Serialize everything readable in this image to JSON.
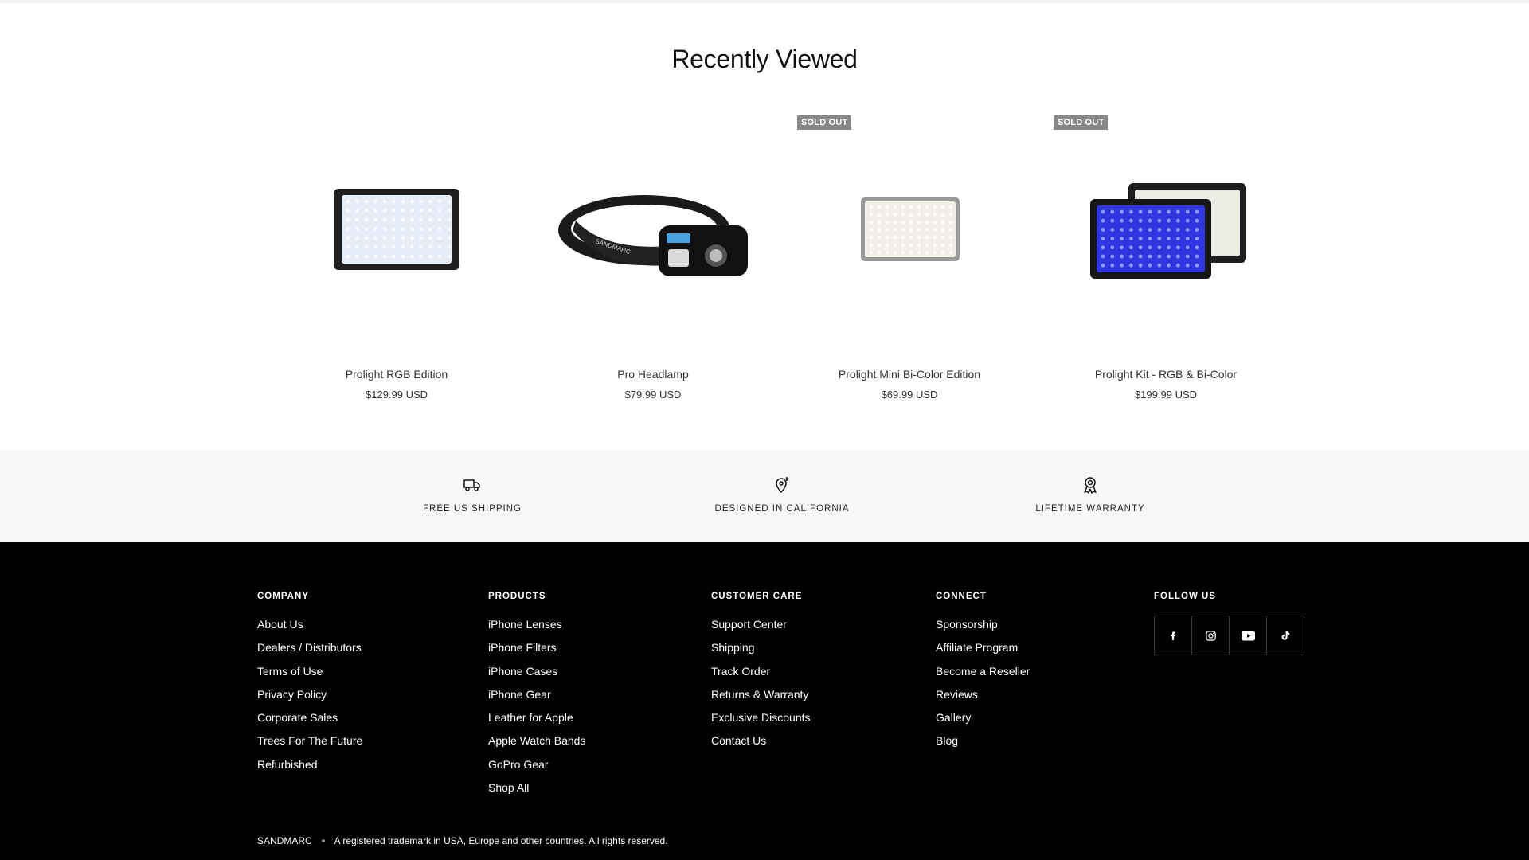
{
  "recently_viewed": {
    "title": "Recently Viewed",
    "products": [
      {
        "name": "Prolight RGB Edition",
        "price": "$129.99 USD",
        "badge": ""
      },
      {
        "name": "Pro Headlamp",
        "price": "$79.99 USD",
        "badge": ""
      },
      {
        "name": "Prolight Mini Bi-Color Edition",
        "price": "$69.99 USD",
        "badge": "SOLD OUT"
      },
      {
        "name": "Prolight Kit - RGB & Bi-Color",
        "price": "$199.99 USD",
        "badge": "SOLD OUT"
      }
    ],
    "headlamp_brand_text": "SANDMARC"
  },
  "features": [
    {
      "label": "FREE US SHIPPING",
      "icon": "truck-icon"
    },
    {
      "label": "DESIGNED IN CALIFORNIA",
      "icon": "location-pin-icon"
    },
    {
      "label": "LIFETIME WARRANTY",
      "icon": "award-ribbon-icon"
    }
  ],
  "footer": {
    "columns": [
      {
        "heading": "COMPANY",
        "links": [
          "About Us",
          "Dealers / Distributors",
          "Terms of Use",
          "Privacy Policy",
          "Corporate Sales",
          "Trees For The Future",
          "Refurbished"
        ]
      },
      {
        "heading": "PRODUCTS",
        "links": [
          "iPhone Lenses",
          "iPhone Filters",
          "iPhone Cases",
          "iPhone Gear",
          "Leather for Apple",
          "Apple Watch Bands",
          "GoPro Gear",
          "Shop All"
        ]
      },
      {
        "heading": "CUSTOMER CARE",
        "links": [
          "Support Center",
          "Shipping",
          "Track Order",
          "Returns & Warranty",
          "Exclusive Discounts",
          "Contact Us"
        ]
      },
      {
        "heading": "CONNECT",
        "links": [
          "Sponsorship",
          "Affiliate Program",
          "Become a Reseller",
          "Reviews",
          "Gallery",
          "Blog"
        ]
      }
    ],
    "follow": {
      "heading": "FOLLOW US",
      "icons": [
        "facebook-icon",
        "instagram-icon",
        "youtube-icon",
        "tiktok-icon"
      ]
    },
    "copyright": {
      "brand": "SANDMARC",
      "text": "A registered trademark in USA, Europe and other countries. All rights reserved."
    }
  },
  "colors": {
    "badge_bg": "#888888",
    "features_bg": "#f7f7f7",
    "footer_bg": "#000000",
    "rgb_led_blue": "#2f36e0"
  }
}
